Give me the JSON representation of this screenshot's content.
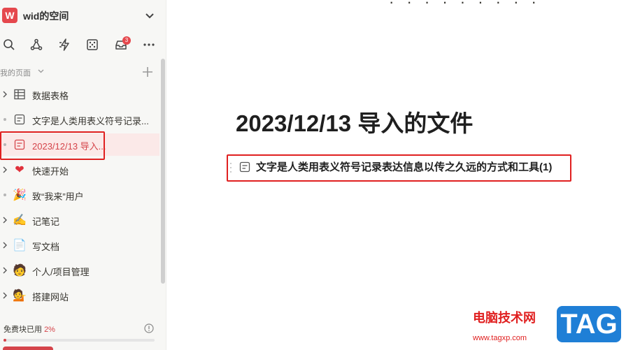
{
  "workspace": {
    "logo_letter": "W",
    "name": "wid的空间"
  },
  "toolbar": {
    "icons": [
      "search-icon",
      "graph-icon",
      "lightning-icon",
      "dice-icon",
      "inbox-icon",
      "more-icon"
    ],
    "inbox_badge": "3"
  },
  "sidebar": {
    "section_label": "我的页面",
    "items": [
      {
        "label": "数据表格",
        "icon": "table-icon",
        "expandable": true
      },
      {
        "label": "文字是人类用表义符号记录...",
        "icon": "doc-icon",
        "expandable": false
      },
      {
        "label": "2023/12/13 导入...",
        "icon": "doc-icon",
        "expandable": false,
        "active": true
      },
      {
        "label": "快速开始",
        "icon": "heart-icon",
        "glyph": "❤",
        "expandable": true
      },
      {
        "label": "致“我来”用户",
        "icon": "party-icon",
        "glyph": "🎉",
        "expandable": false
      },
      {
        "label": "记笔记",
        "icon": "writing-hand-icon",
        "glyph": "✍",
        "expandable": true
      },
      {
        "label": "写文档",
        "icon": "document-icon",
        "glyph": "📄",
        "expandable": true
      },
      {
        "label": "个人/项目管理",
        "icon": "person-icon",
        "glyph": "🧑",
        "expandable": true
      },
      {
        "label": "搭建网站",
        "icon": "person-tipping-icon",
        "glyph": "💁",
        "expandable": true
      }
    ]
  },
  "usage": {
    "label": "免费块已用",
    "percent_text": "2%",
    "percent": 2
  },
  "main": {
    "top_cut_text": "· ·   ·     ·  ·  ·  ·  ·  ·",
    "page_title": "2023/12/13 导入的文件",
    "block_text": "文字是人类用表义符号记录表达信息以传之久远的方式和工具(1)"
  },
  "watermark": {
    "site_cn": "电脑技术网",
    "url": "www.tagxp.com",
    "tag": "TAG"
  },
  "colors": {
    "accent": "#d5444a",
    "highlight_box": "#e02020",
    "watermark_blue": "#1f7fd6"
  }
}
